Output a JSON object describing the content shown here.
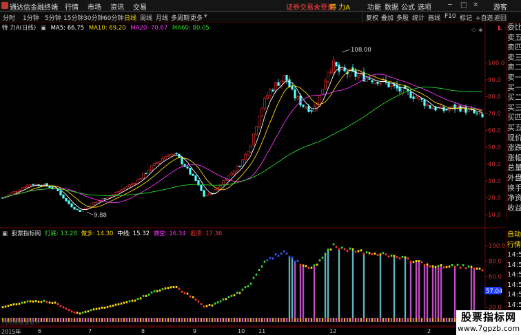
{
  "window": {
    "title": "通达信金融终端",
    "menu": [
      "行情",
      "市场",
      "资讯",
      "交易"
    ],
    "notice": "证券交易未登录",
    "stock": "特 力A",
    "right_menu": [
      "功能",
      "数据",
      "公式",
      "选项"
    ],
    "user": "游客"
  },
  "toolbar": {
    "periods": [
      "分时",
      "1分钟",
      "5分钟",
      "15分钟",
      "30分钟",
      "60分钟",
      "日线",
      "周线",
      "月线",
      "多周期",
      "更多"
    ],
    "selected": "日线",
    "right_buttons": [
      "复权",
      "叠加",
      "多股",
      "统计",
      "画线",
      "F10",
      "标记",
      "+自选",
      "返回"
    ]
  },
  "main": {
    "title": "特 力A(日线)",
    "ma": [
      {
        "label": "MA5: 66.75",
        "color": "#ffffff"
      },
      {
        "label": "MA10: 69.20",
        "color": "#ffd800"
      },
      {
        "label": "MA20: 70.67",
        "color": "#ff33ff"
      },
      {
        "label": "MA60: 80.05",
        "color": "#22dd22"
      }
    ],
    "high_label": "108.00",
    "low_label": "9.88",
    "price_axis": [
      "100.0",
      "90.0",
      "80.0",
      "70.0",
      "60.0",
      "50.0",
      "40.0",
      "30.0",
      "20.0",
      "10.0"
    ],
    "corner_label": "L"
  },
  "indicator": {
    "title": "股票指标网",
    "items": [
      {
        "label": "打底: 13.28",
        "color": "#33dd33"
      },
      {
        "label": "做多: 14.30",
        "color": "#ffd800"
      },
      {
        "label": "中线: 15.32",
        "color": "#ffffff"
      },
      {
        "label": "做空: 16.34",
        "color": "#ff33ff"
      },
      {
        "label": "逃顶: 17.36",
        "color": "#ff3333"
      }
    ],
    "axis": [
      "100.0",
      "80.0",
      "60.0",
      "40.0",
      "20.0"
    ],
    "current": "57.04",
    "watermark_left": "同花顺股票软件"
  },
  "side_panel": [
    "委比",
    "卖五",
    "卖四",
    "卖三",
    "卖二",
    "卖一",
    "买一",
    "买二",
    "买三",
    "买四",
    "买五",
    "现价",
    "涨跌",
    "涨幅",
    "总量",
    "外盘",
    "换手",
    "净资",
    "收益"
  ],
  "side_panel2": [
    "自动",
    "行情",
    "14:50",
    "14:50",
    "14:50",
    "14:50",
    "14:50",
    "14:50",
    "14:50",
    "14:50"
  ],
  "dates": {
    "year": "2015年",
    "months": [
      "6",
      "7",
      "8",
      "9",
      "10",
      "11",
      "12",
      "2"
    ]
  },
  "watermark": {
    "line1": "股票指标网",
    "line2": "www.7gpzb.com"
  }
}
